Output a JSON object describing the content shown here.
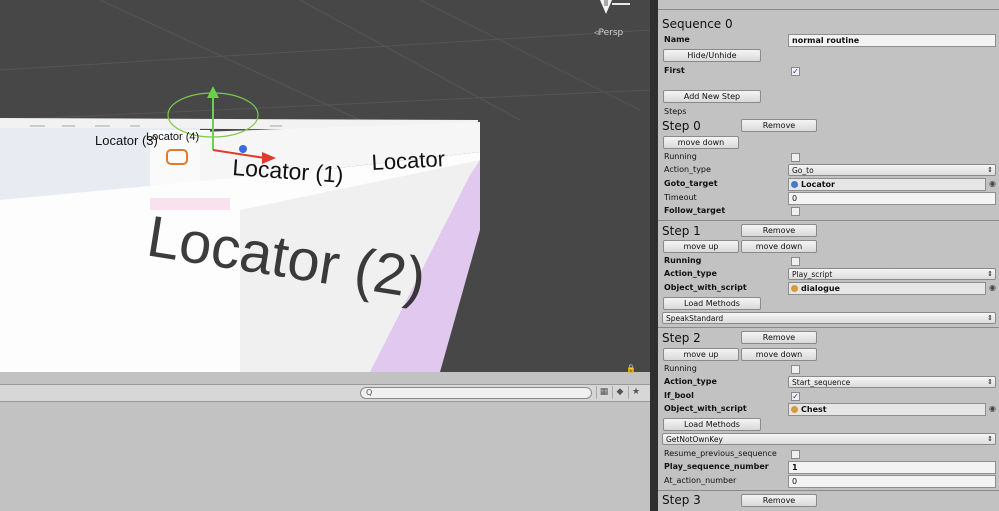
{
  "scene": {
    "persp_label": "◃Persp",
    "labels": {
      "locator": "Locator",
      "locator1": "Locator (1)",
      "locator2": "Locator (2)",
      "locator3": "Locator (3)",
      "locator4": "Locator (4)"
    }
  },
  "bottom": {
    "search_placeholder": "Q",
    "icons": [
      "layers-icon",
      "tag-icon",
      "star-icon"
    ]
  },
  "inspector": {
    "sequence_title": "Sequence 0",
    "name_label": "Name",
    "name_value": "normal routine",
    "hide_unhide": "Hide/Unhide",
    "first_label": "First",
    "first_checked": true,
    "add_new_step": "Add New Step",
    "steps_label": "Steps",
    "steps": [
      {
        "title": "Step 0",
        "remove": "Remove",
        "move_down": "move down",
        "running_label": "Running",
        "action_type_label": "Action_type",
        "action_type": "Go_to",
        "goto_target_label": "Goto_target",
        "goto_target": "Locator",
        "timeout_label": "Timeout",
        "timeout": "0",
        "follow_target_label": "Follow_target"
      },
      {
        "title": "Step 1",
        "remove": "Remove",
        "move_up": "move up",
        "move_down": "move down",
        "running_label": "Running",
        "action_type_label": "Action_type",
        "action_type": "Play_script",
        "object_with_script_label": "Object_with_script",
        "object_with_script": "dialogue",
        "load_methods": "Load Methods",
        "method": "SpeakStandard"
      },
      {
        "title": "Step 2",
        "remove": "Remove",
        "move_up": "move up",
        "move_down": "move down",
        "running_label": "Running",
        "action_type_label": "Action_type",
        "action_type": "Start_sequence",
        "if_bool_label": "If_bool",
        "if_bool_checked": true,
        "object_with_script_label": "Object_with_script",
        "object_with_script": "Chest",
        "load_methods": "Load Methods",
        "method": "GetNotOwnKey",
        "resume_label": "Resume_previous_sequence",
        "play_seq_label": "Play_sequence_number",
        "play_seq_value": "1",
        "at_action_label": "At_action_number",
        "at_action_value": "0"
      },
      {
        "title": "Step 3",
        "remove": "Remove"
      }
    ]
  }
}
